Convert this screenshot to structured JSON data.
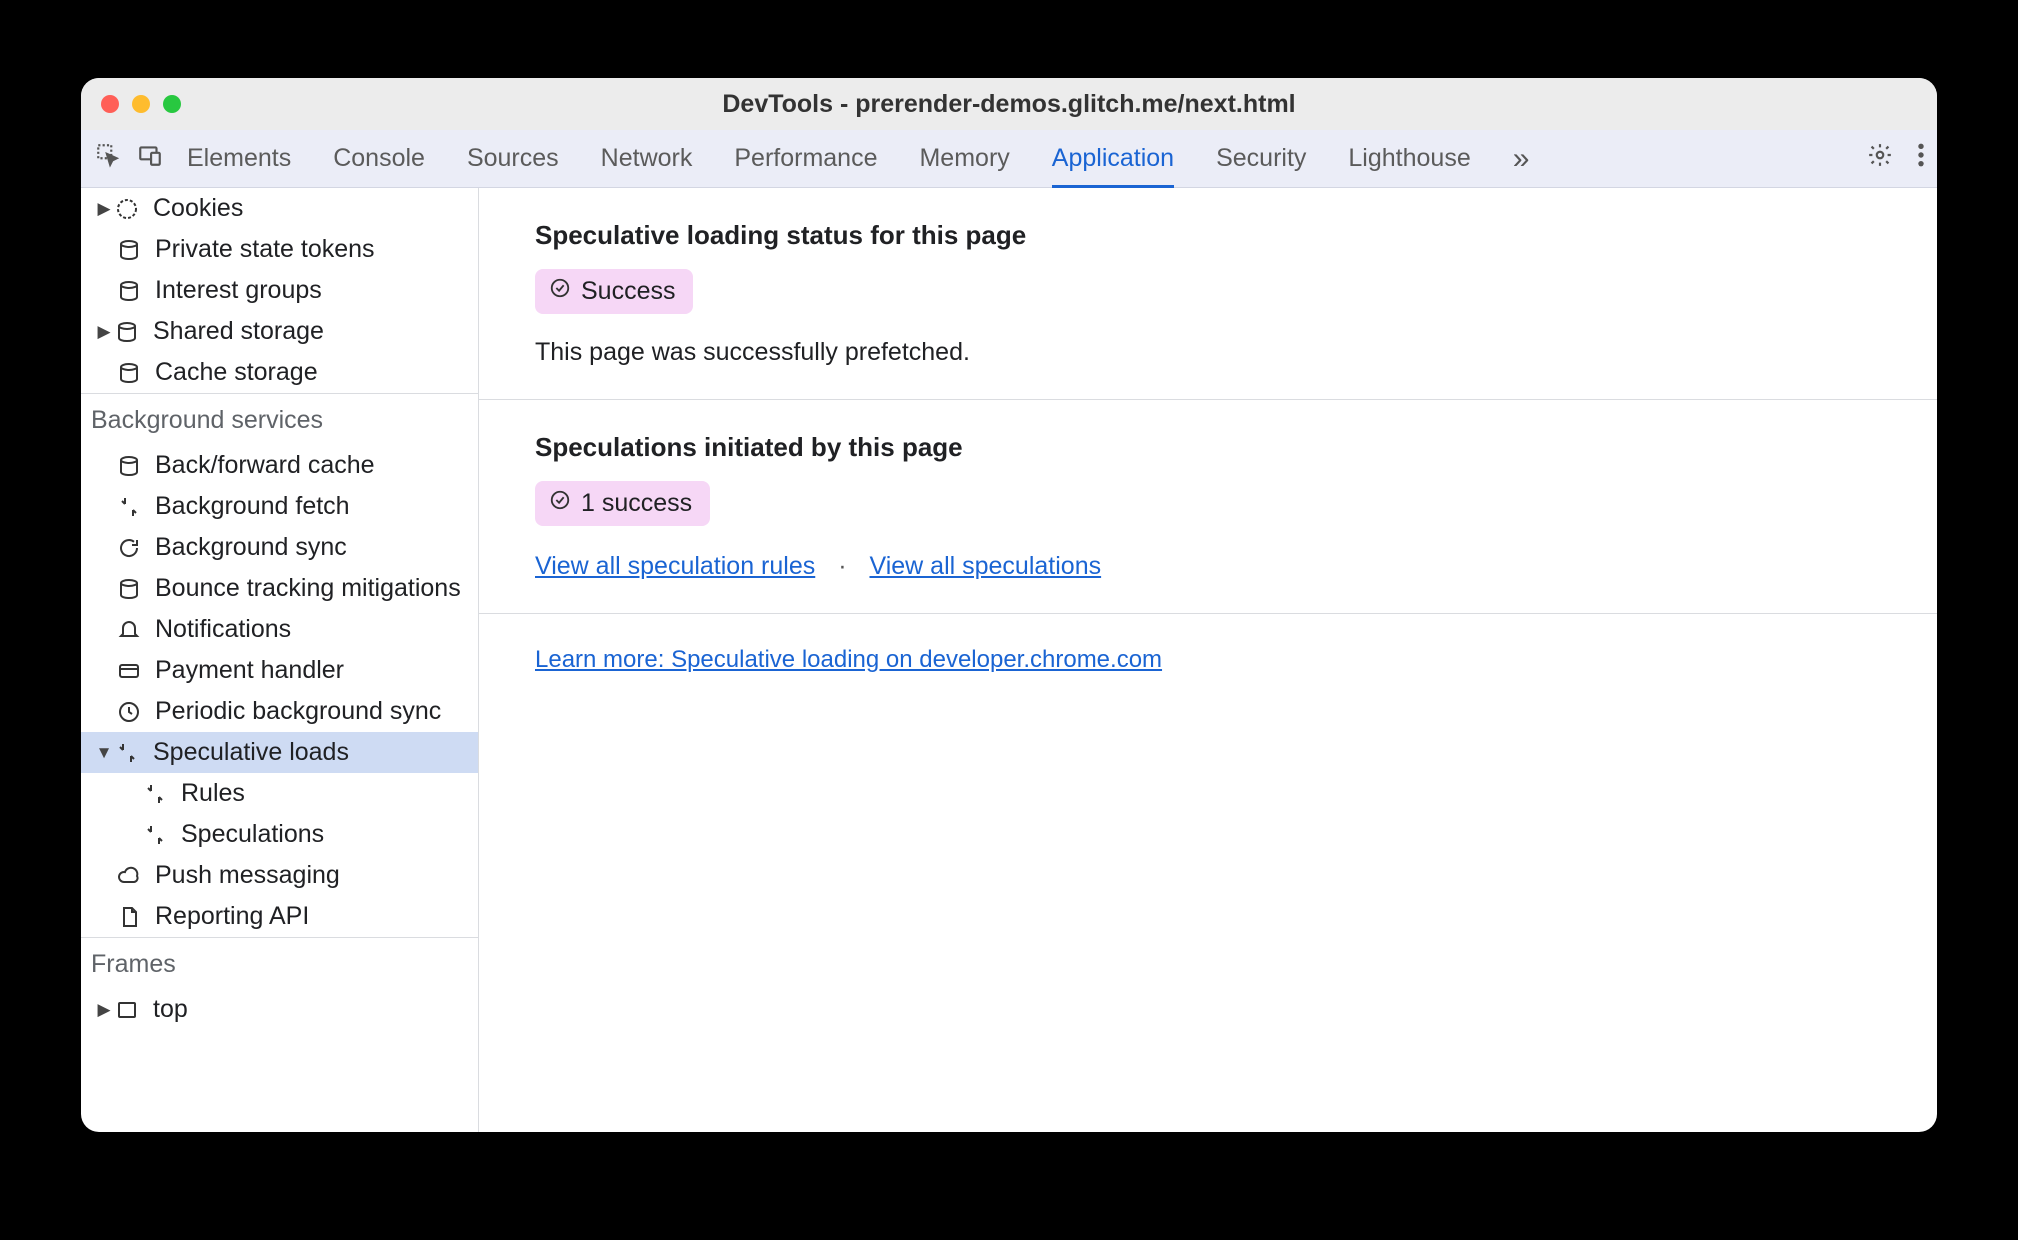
{
  "window": {
    "title": "DevTools - prerender-demos.glitch.me/next.html"
  },
  "tabs": {
    "items": [
      "Elements",
      "Console",
      "Sources",
      "Network",
      "Performance",
      "Memory",
      "Application",
      "Security",
      "Lighthouse"
    ],
    "active": "Application"
  },
  "sidebar": {
    "storage": {
      "cookies": "Cookies",
      "private_state_tokens": "Private state tokens",
      "interest_groups": "Interest groups",
      "shared_storage": "Shared storage",
      "cache_storage": "Cache storage"
    },
    "background": {
      "header": "Background services",
      "back_forward_cache": "Back/forward cache",
      "background_fetch": "Background fetch",
      "background_sync": "Background sync",
      "bounce_tracking": "Bounce tracking mitigations",
      "notifications": "Notifications",
      "payment_handler": "Payment handler",
      "periodic_bg_sync": "Periodic background sync",
      "speculative_loads": "Speculative loads",
      "rules": "Rules",
      "speculations": "Speculations",
      "push_messaging": "Push messaging",
      "reporting_api": "Reporting API"
    },
    "frames": {
      "header": "Frames",
      "top": "top"
    }
  },
  "main": {
    "status_title": "Speculative loading status for this page",
    "status_badge": "Success",
    "status_desc": "This page was successfully prefetched.",
    "spec_title": "Speculations initiated by this page",
    "spec_badge": "1 success",
    "link_rules": "View all speculation rules",
    "link_specs": "View all speculations",
    "learn_more": "Learn more: Speculative loading on developer.chrome.com"
  }
}
